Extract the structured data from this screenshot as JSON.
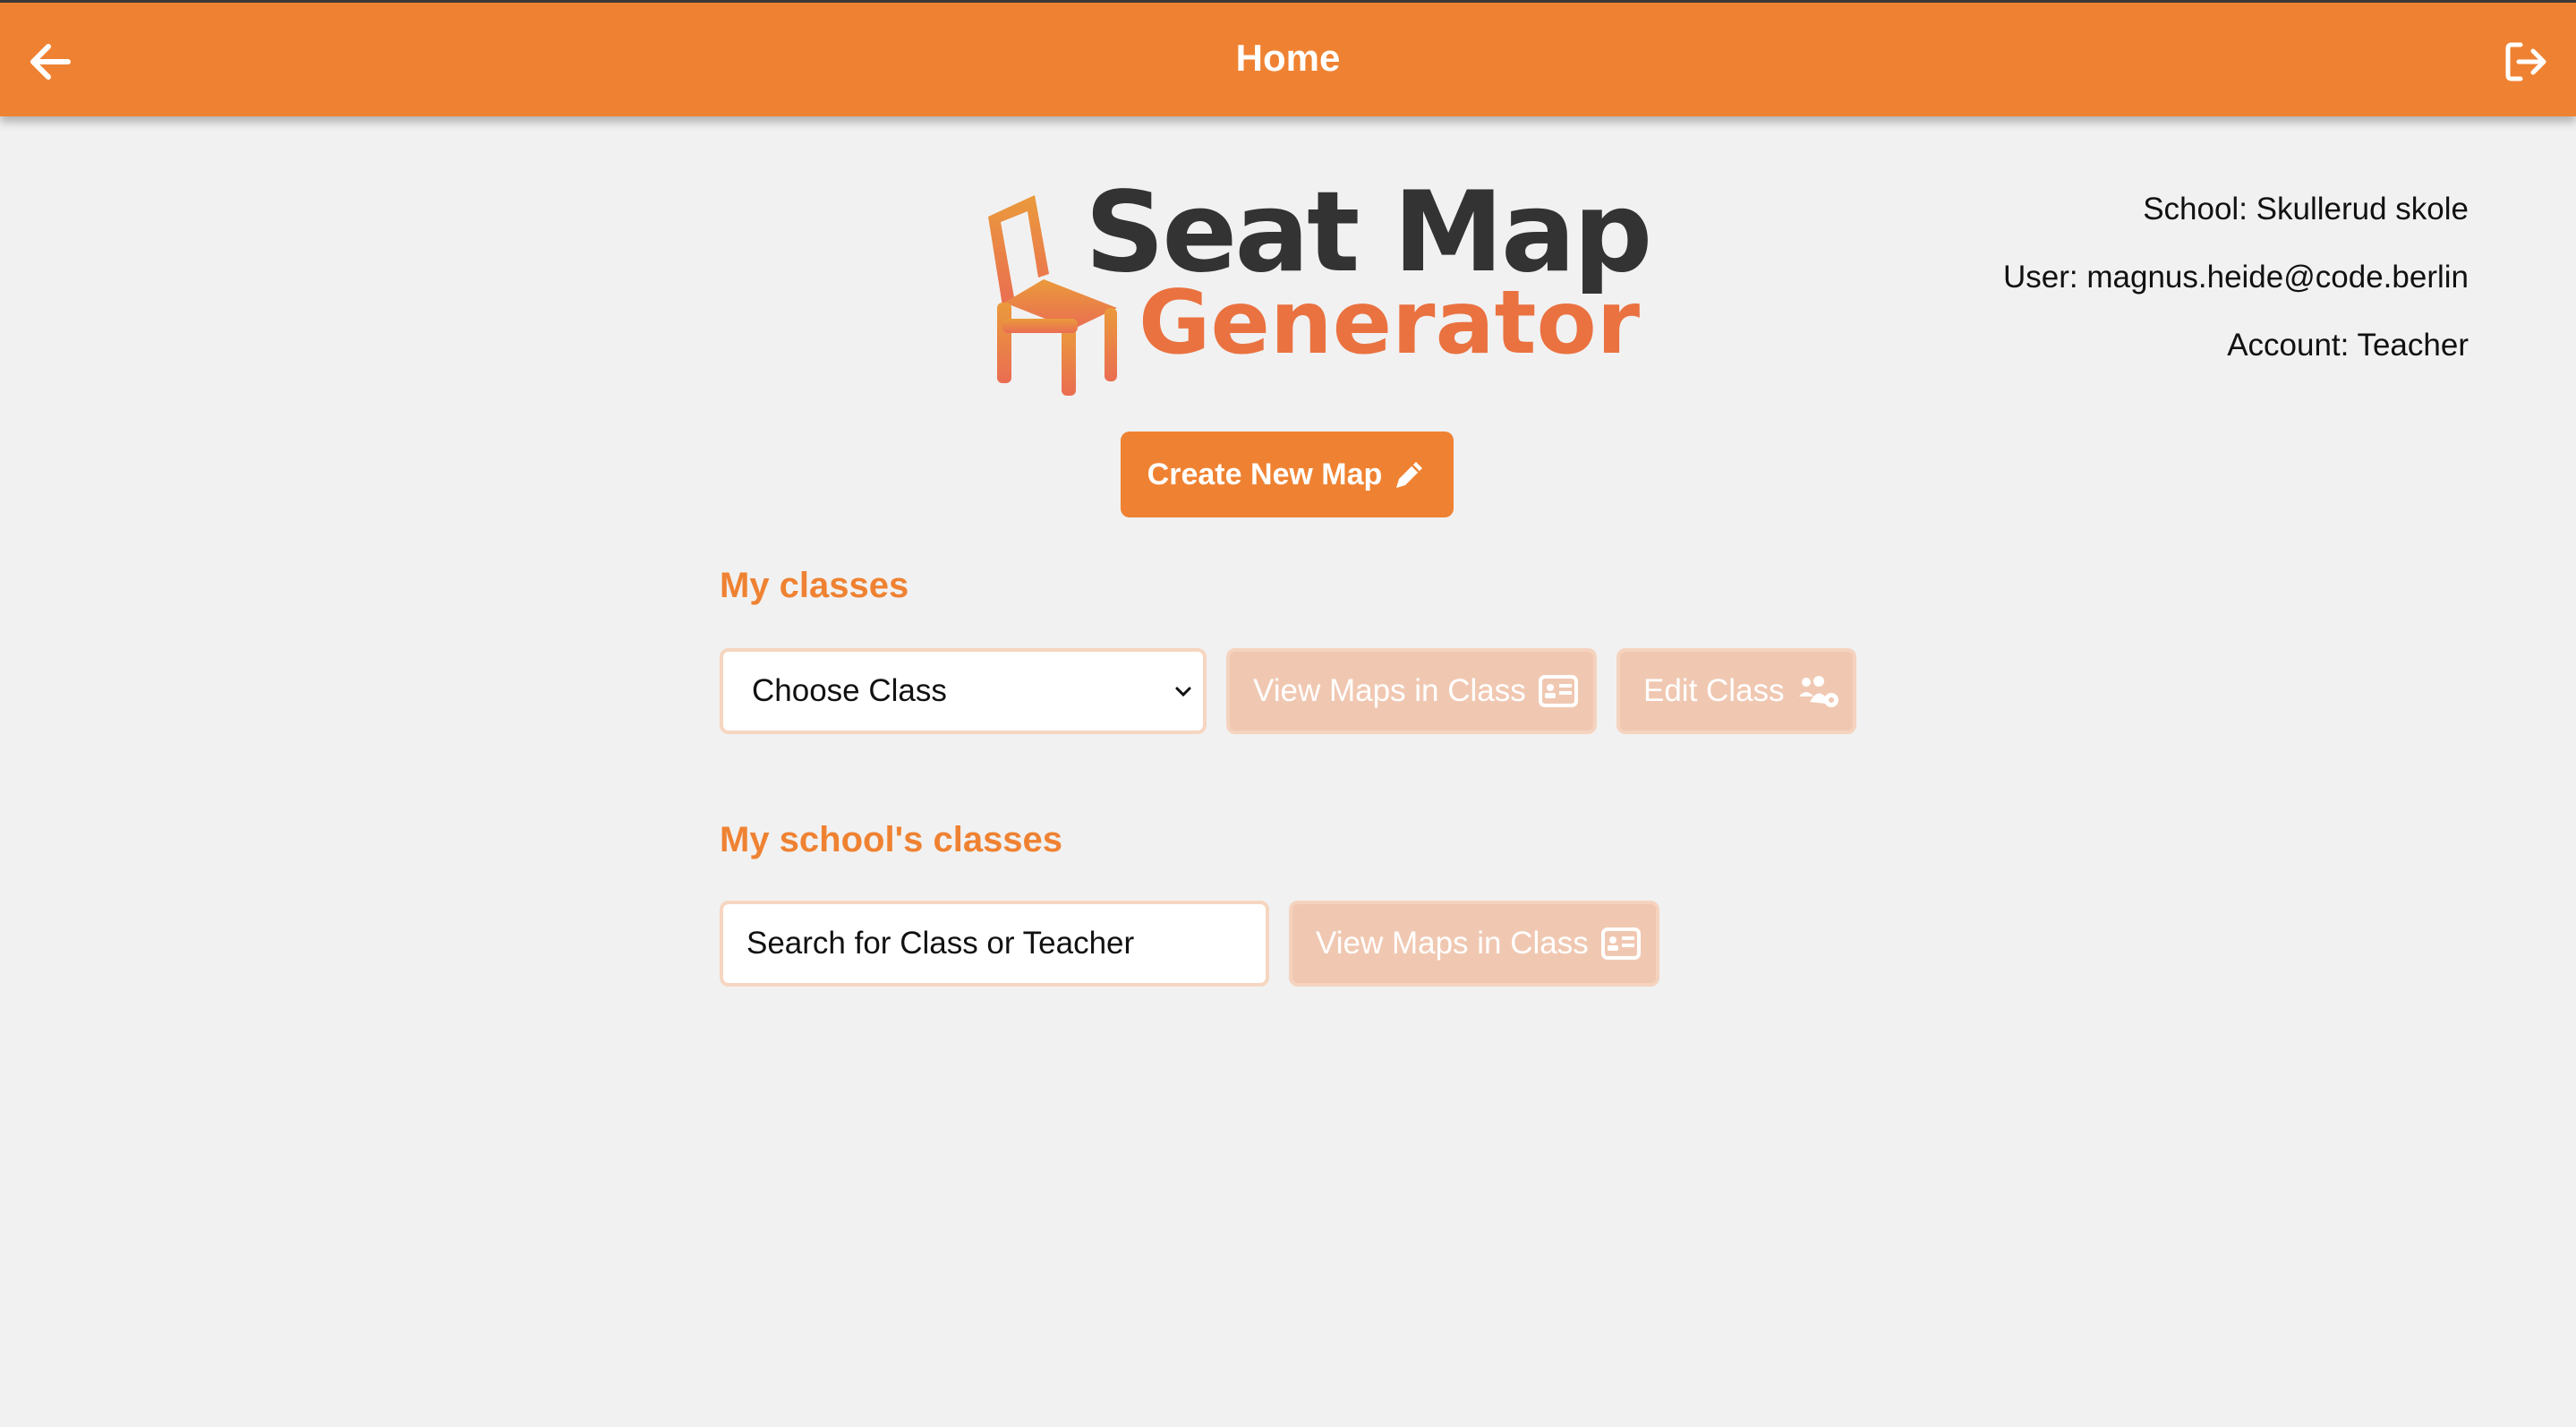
{
  "header": {
    "title": "Home",
    "back_icon": "arrow-left-icon",
    "logout_icon": "sign-out-icon",
    "background_color": "#ef8232"
  },
  "user_info": {
    "school": "School: Skullerud skole",
    "user": "User: magnus.heide@code.berlin",
    "account": "Account: Teacher"
  },
  "logo": {
    "line1": "Seat Map",
    "line2": "Generator",
    "icon": "chair-icon"
  },
  "create_button": {
    "label": "Create New Map",
    "icon": "pencil-icon"
  },
  "my_classes": {
    "title": "My classes",
    "select_value": "Choose Class",
    "view_maps_label": "View Maps in Class",
    "view_maps_icon": "id-card-icon",
    "edit_class_label": "Edit Class",
    "edit_class_icon": "users-cog-icon"
  },
  "school_classes": {
    "title": "My school's classes",
    "search_placeholder": "Search for Class or Teacher",
    "view_maps_label": "View Maps in Class",
    "view_maps_icon": "id-card-icon"
  },
  "colors": {
    "accent": "#ef8232",
    "disabled_button": "#f0c8b2",
    "page_background": "#f1f1f1"
  }
}
